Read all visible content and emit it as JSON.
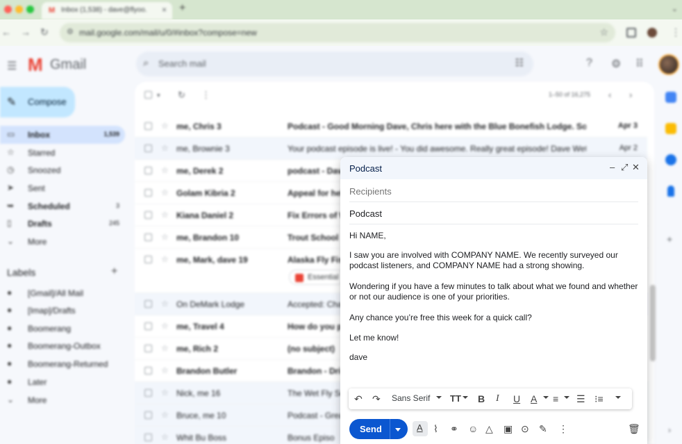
{
  "browser": {
    "tab_title": "Inbox (1,538) - dave@flyoo...",
    "tab_favicon": "M",
    "url": "mail.google.com/mail/u/0/#inbox?compose=new"
  },
  "gmail": {
    "logo_letter": "M",
    "product_name": "Gmail",
    "search_placeholder": "Search mail",
    "compose_label": "Compose",
    "nav": [
      {
        "label": "Inbox",
        "count": "1,539",
        "icon": "inbox-icon"
      },
      {
        "label": "Starred",
        "count": "",
        "icon": "star-icon"
      },
      {
        "label": "Snoozed",
        "count": "",
        "icon": "clock-icon"
      },
      {
        "label": "Sent",
        "count": "",
        "icon": "send-icon"
      },
      {
        "label": "Scheduled",
        "count": "3",
        "icon": "schedule-icon"
      },
      {
        "label": "Drafts",
        "count": "245",
        "icon": "draft-icon"
      },
      {
        "label": "More",
        "count": "",
        "icon": "chevron-down-icon"
      }
    ],
    "labels_title": "Labels",
    "labels": [
      {
        "label": "[Gmail]/All Mail"
      },
      {
        "label": "[Imap]/Drafts"
      },
      {
        "label": "Boomerang"
      },
      {
        "label": "Boomerang-Outbox"
      },
      {
        "label": "Boomerang-Returned"
      },
      {
        "label": "Later"
      },
      {
        "label": "More"
      }
    ],
    "pager": "1–50 of 16,275",
    "rows": [
      {
        "sender": "me, Chris 3",
        "subject": "Podcast - Good Morning Dave, Chris here with the Blue Bonefish Lodge. Sorry for ...",
        "date": "Apr 3"
      },
      {
        "sender": "me, Brownie 3",
        "subject": "Your podcast episode is live! - You did awesome. Really great episode! Dave WetFly...",
        "date": "Apr 2"
      },
      {
        "sender": "me, Derek 2",
        "subject": "podcast - Dave",
        "date": ""
      },
      {
        "sender": "Golam Kibria 2",
        "subject": "Appeal for help",
        "date": ""
      },
      {
        "sender": "Kiana Daniel 2",
        "subject": "Fix Errors of W",
        "date": ""
      },
      {
        "sender": "me, Brandon 10",
        "subject": "Trout School",
        "date": ""
      },
      {
        "sender": "me, Mark, dave 19",
        "subject": "Alaska Fly Fis",
        "date": ""
      },
      {
        "sender": "On DeMark Lodge",
        "subject": "Accepted: Cha",
        "date": ""
      },
      {
        "sender": "me, Travel 4",
        "subject": "How do you p",
        "date": ""
      },
      {
        "sender": "me, Rich 2",
        "subject": "(no subject)",
        "date": ""
      },
      {
        "sender": "Brandon Butler",
        "subject": "Brandon - Dri",
        "date": ""
      },
      {
        "sender": "Nick, me 16",
        "subject": "The Wet Fly Se",
        "date": ""
      },
      {
        "sender": "Bruce, me 10",
        "subject": "Podcast - Grea",
        "date": ""
      },
      {
        "sender": "Whit Bu Boss",
        "subject": "Bonus Episo",
        "date": ""
      }
    ],
    "attachment_chip": "Essential"
  },
  "compose": {
    "title": "Podcast",
    "recipients_placeholder": "Recipients",
    "subject": "Podcast",
    "body": [
      "Hi NAME,",
      "I saw you are involved with COMPANY NAME. We recently surveyed our podcast listeners, and COMPANY NAME had a strong showing.",
      "Wondering if you have a few minutes to talk about what we found and whether or not our audience is one of your priorities.",
      "Any chance you’re free this week for a quick call?",
      "Let me know!",
      "dave"
    ],
    "font_name": "Sans Serif",
    "send_label": "Send"
  },
  "colors": {
    "send_button": "#0b57d0",
    "compose_button": "#c2e7ff",
    "active_nav": "#d3e3fd",
    "tabbar": "#d6e6cf"
  }
}
